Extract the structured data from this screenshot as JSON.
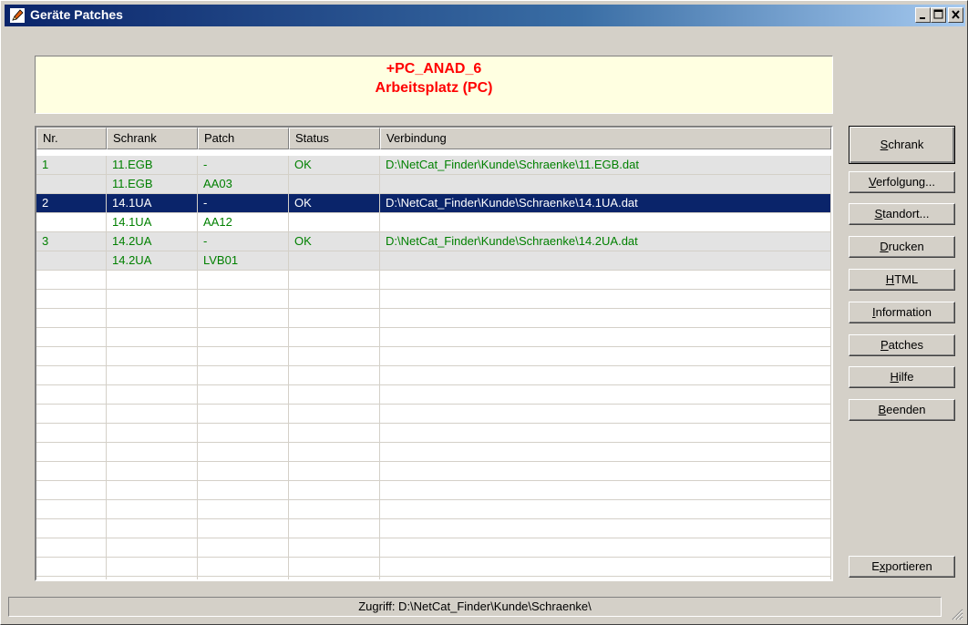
{
  "window": {
    "title": "Geräte Patches"
  },
  "header": {
    "line1": "+PC_ANAD_6",
    "line2": "Arbeitsplatz (PC)"
  },
  "grid": {
    "columns": [
      "Nr.",
      "Schrank",
      "Patch",
      "Status",
      "Verbindung"
    ],
    "rows": [
      {
        "nr": "1",
        "schrank": "11.EGB",
        "patch": "-",
        "status": "OK",
        "verbindung": "D:\\NetCat_Finder\\Kunde\\Schraenke\\11.EGB.dat"
      },
      {
        "nr": "",
        "schrank": "11.EGB",
        "patch": "AA03",
        "status": "",
        "verbindung": ""
      },
      {
        "nr": "2",
        "schrank": "14.1UA",
        "patch": "-",
        "status": "OK",
        "verbindung": "D:\\NetCat_Finder\\Kunde\\Schraenke\\14.1UA.dat"
      },
      {
        "nr": "",
        "schrank": "14.1UA",
        "patch": "AA12",
        "status": "",
        "verbindung": ""
      },
      {
        "nr": "3",
        "schrank": "14.2UA",
        "patch": "-",
        "status": "OK",
        "verbindung": "D:\\NetCat_Finder\\Kunde\\Schraenke\\14.2UA.dat"
      },
      {
        "nr": "",
        "schrank": "14.2UA",
        "patch": "LVB01",
        "status": "",
        "verbindung": ""
      }
    ]
  },
  "buttons": {
    "schrank": {
      "pre": "",
      "key": "S",
      "post": "chrank"
    },
    "verfolgung": {
      "pre": "",
      "key": "V",
      "post": "erfolgung..."
    },
    "standort": {
      "pre": "",
      "key": "S",
      "post": "tandort..."
    },
    "drucken": {
      "pre": "",
      "key": "D",
      "post": "rucken"
    },
    "html": {
      "pre": "",
      "key": "H",
      "post": "TML"
    },
    "information": {
      "pre": "",
      "key": "I",
      "post": "nformation"
    },
    "patches": {
      "pre": "",
      "key": "P",
      "post": "atches"
    },
    "hilfe": {
      "pre": "",
      "key": "H",
      "post": "ilfe"
    },
    "beenden": {
      "pre": "",
      "key": "B",
      "post": "eenden"
    },
    "exportieren": {
      "pre": "E",
      "key": "x",
      "post": "portieren"
    }
  },
  "statusbar": {
    "text": "Zugriff: D:\\NetCat_Finder\\Kunde\\Schraenke\\"
  },
  "colors": {
    "title_start": "#0a246a",
    "header_bg": "#ffffe1",
    "header_text": "#ff0000",
    "row_text": "#008000",
    "selected_bg": "#0a246a"
  }
}
